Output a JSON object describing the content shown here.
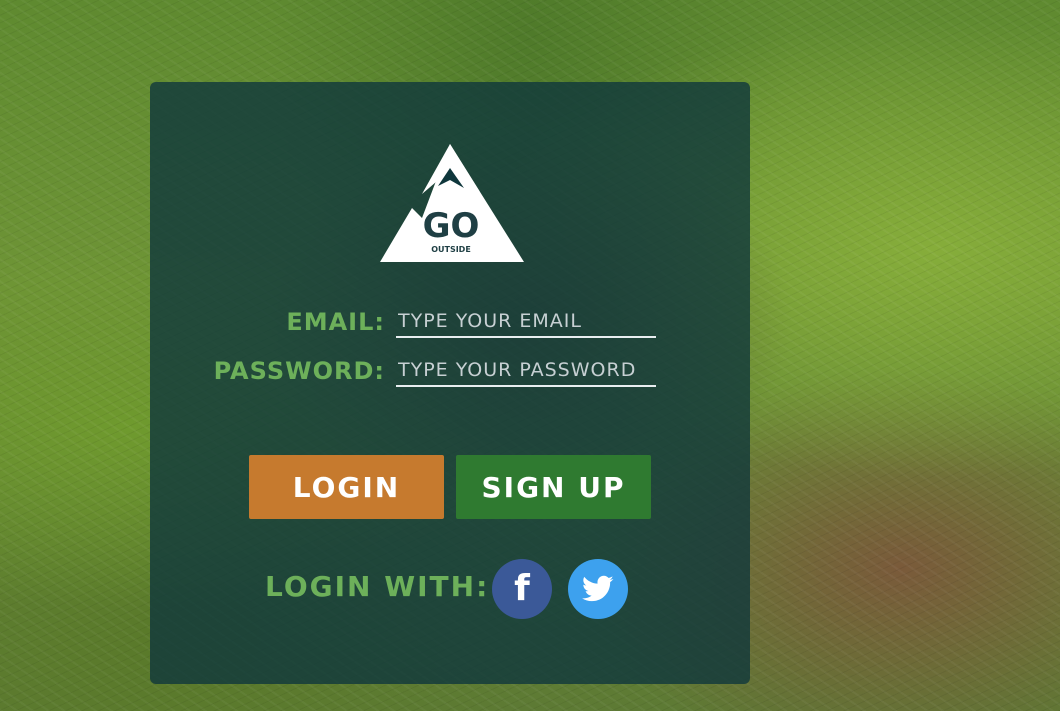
{
  "logo": {
    "word": "GO",
    "sub": "OUTSIDE"
  },
  "form": {
    "email_label": "Email:",
    "email_placeholder": "Type your email",
    "password_label": "Password:",
    "password_placeholder": "Type your password"
  },
  "buttons": {
    "login": "Login",
    "signup": "Sign Up"
  },
  "social": {
    "label": "Login with:",
    "facebook_icon": "facebook-icon",
    "twitter_icon": "twitter-icon"
  },
  "colors": {
    "label_green": "#6db05a",
    "login_orange": "#c67a2e",
    "signup_green": "#2f7a30",
    "facebook_blue": "#3b5998",
    "twitter_blue": "#3da1ee",
    "panel": "#0f373c"
  }
}
